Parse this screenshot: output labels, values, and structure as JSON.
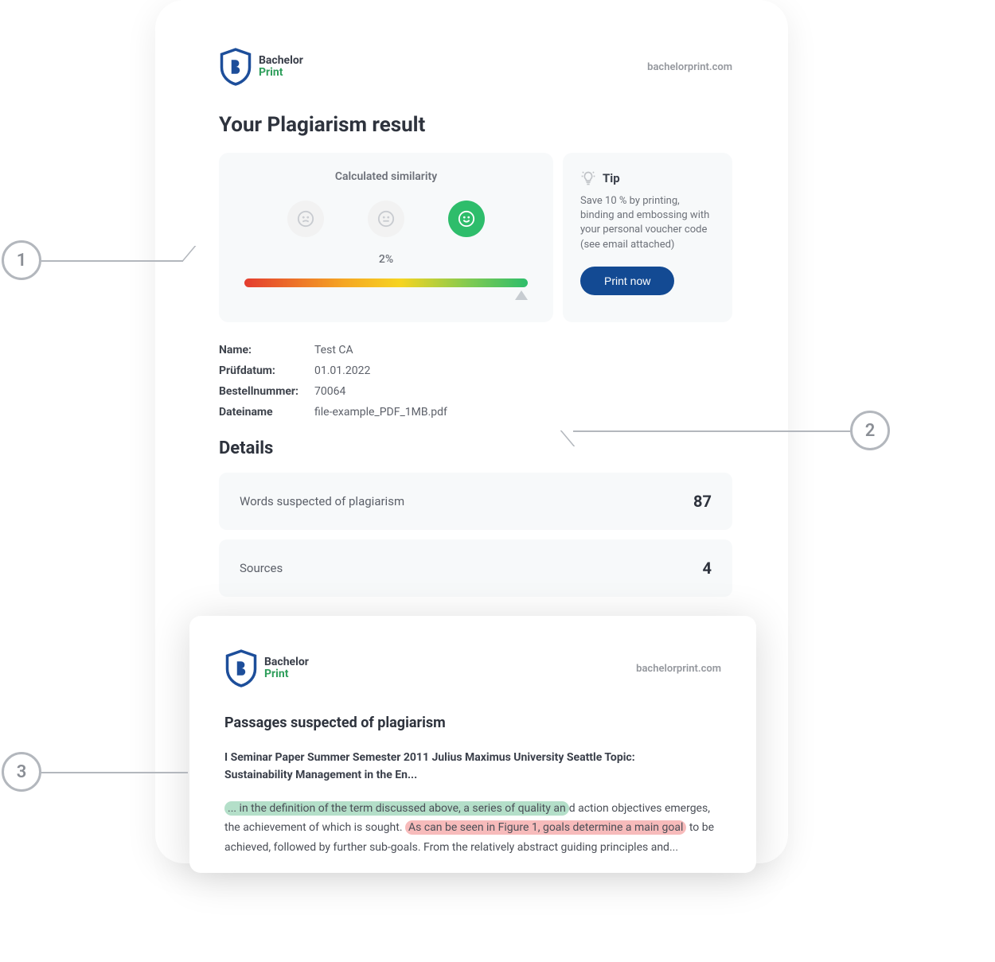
{
  "brand": {
    "name_line1": "Bachelor",
    "name_line2": "Print",
    "site_url": "bachelorprint.com"
  },
  "report": {
    "title": "Your Plagiarism result",
    "similarity": {
      "label": "Calculated similarity",
      "value_text": "2%",
      "percent": 2,
      "mood": "happy"
    },
    "tip": {
      "heading": "Tip",
      "text": "Save 10 % by printing, binding and embossing with your personal voucher code (see email attached)",
      "button": "Print now"
    },
    "meta": {
      "name_label": "Name:",
      "name_value": "Test CA",
      "date_label": "Prüfdatum:",
      "date_value": "01.01.2022",
      "order_label": "Bestellnummer:",
      "order_value": "70064",
      "file_label": "Dateiname",
      "file_value": "file-example_PDF_1MB.pdf"
    },
    "details": {
      "heading": "Details",
      "words_label": "Words suspected of plagiarism",
      "words_value": "87",
      "sources_label": "Sources",
      "sources_value": "4"
    }
  },
  "passages": {
    "heading": "Passages suspected of plagiarism",
    "seminar_line1": "I Seminar Paper Summer Semester 2011 Julius Maximus University Seattle Topic:",
    "seminar_line2": "Sustainability Management in the En...",
    "excerpt": {
      "seg1_green": "... in the definition of the term discussed above, a series of quality an",
      "seg2": "d action objectives emerges, the achievement of which is sought. ",
      "seg3_red": "As can be seen in Figure 1, goals determine a main goal",
      "seg4": " to be achieved, followed by further sub-goals. From the relatively abstract guiding principles and..."
    }
  },
  "annotations": {
    "a1": "1",
    "a2": "2",
    "a3": "3"
  },
  "colors": {
    "accent_blue": "#134a93",
    "accent_green": "#2ebd6b",
    "panel_bg": "#f7f9fa"
  },
  "chart_data": {
    "type": "bar",
    "title": "Calculated similarity",
    "categories": [
      "Similarity"
    ],
    "values": [
      2
    ],
    "ylim": [
      0,
      100
    ],
    "ylabel": "%",
    "xlabel": ""
  }
}
